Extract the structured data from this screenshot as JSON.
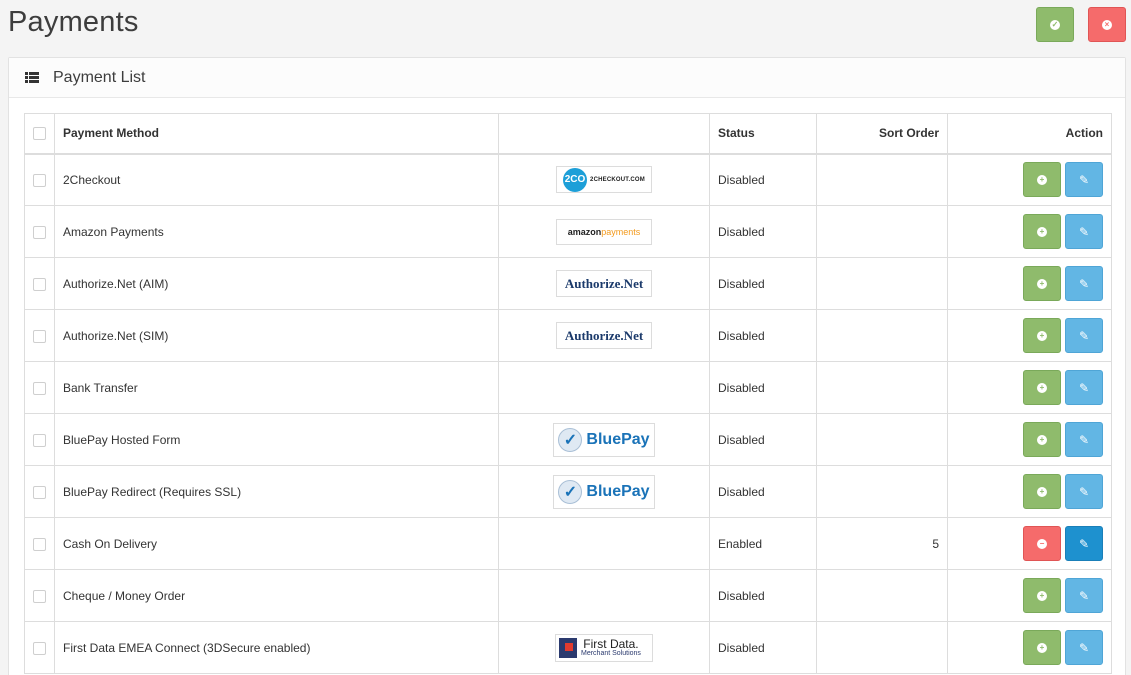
{
  "page": {
    "title": "Payments",
    "save_icon": "check-circle-icon",
    "cancel_icon": "times-circle-icon"
  },
  "panel": {
    "title": "Payment List",
    "icon": "list-icon"
  },
  "table": {
    "headers": {
      "method": "Payment Method",
      "logo": "",
      "status": "Status",
      "sort_order": "Sort Order",
      "action": "Action"
    },
    "rows": [
      {
        "method": "2Checkout",
        "logo": "2checkout",
        "logo_text_a": "2CO",
        "logo_text_b": "2CHECKOUT.COM",
        "status": "Disabled",
        "sort_order": "",
        "installed": false
      },
      {
        "method": "Amazon Payments",
        "logo": "amazon",
        "logo_text_a": "amazon",
        "logo_text_b": "payments",
        "status": "Disabled",
        "sort_order": "",
        "installed": false
      },
      {
        "method": "Authorize.Net (AIM)",
        "logo": "authorize",
        "logo_text_a": "Authorize.Net",
        "logo_text_b": "",
        "status": "Disabled",
        "sort_order": "",
        "installed": false
      },
      {
        "method": "Authorize.Net (SIM)",
        "logo": "authorize",
        "logo_text_a": "Authorize.Net",
        "logo_text_b": "",
        "status": "Disabled",
        "sort_order": "",
        "installed": false
      },
      {
        "method": "Bank Transfer",
        "logo": "",
        "logo_text_a": "",
        "logo_text_b": "",
        "status": "Disabled",
        "sort_order": "",
        "installed": false
      },
      {
        "method": "BluePay Hosted Form",
        "logo": "bluepay",
        "logo_text_a": "BluePay",
        "logo_text_b": "",
        "status": "Disabled",
        "sort_order": "",
        "installed": false
      },
      {
        "method": "BluePay Redirect (Requires SSL)",
        "logo": "bluepay",
        "logo_text_a": "BluePay",
        "logo_text_b": "",
        "status": "Disabled",
        "sort_order": "",
        "installed": false
      },
      {
        "method": "Cash On Delivery",
        "logo": "",
        "logo_text_a": "",
        "logo_text_b": "",
        "status": "Enabled",
        "sort_order": "5",
        "installed": true
      },
      {
        "method": "Cheque / Money Order",
        "logo": "",
        "logo_text_a": "",
        "logo_text_b": "",
        "status": "Disabled",
        "sort_order": "",
        "installed": false
      },
      {
        "method": "First Data EMEA Connect (3DSecure enabled)",
        "logo": "firstdata",
        "logo_text_a": "First Data.",
        "logo_text_b": "Merchant Solutions",
        "status": "Disabled",
        "sort_order": "",
        "installed": false
      }
    ]
  },
  "colors": {
    "install": "#8fbb6c",
    "uninstall": "#f56b6b",
    "edit": "#62b6e4",
    "edit_active": "#1e91cf"
  }
}
